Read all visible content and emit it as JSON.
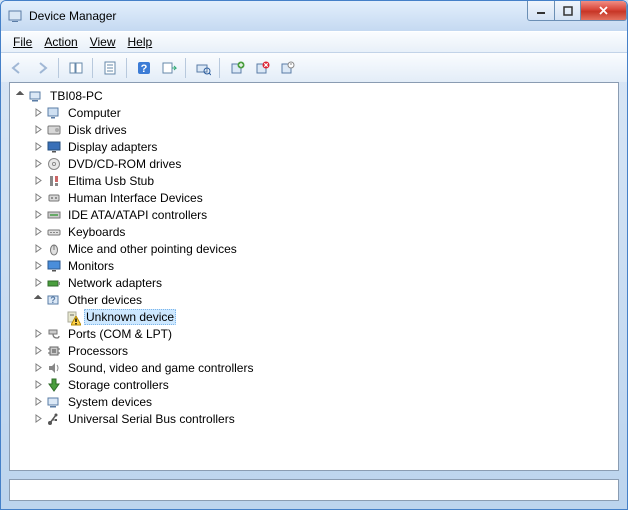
{
  "window": {
    "title": "Device Manager"
  },
  "menu": {
    "file": "File",
    "action": "Action",
    "view": "View",
    "help": "Help"
  },
  "root": {
    "name": "TBI08-PC"
  },
  "categories": [
    {
      "id": "computer",
      "label": "Computer",
      "expanded": false
    },
    {
      "id": "diskdrives",
      "label": "Disk drives",
      "expanded": false
    },
    {
      "id": "display",
      "label": "Display adapters",
      "expanded": false
    },
    {
      "id": "dvd",
      "label": "DVD/CD-ROM drives",
      "expanded": false
    },
    {
      "id": "eltima",
      "label": "Eltima Usb Stub",
      "expanded": false
    },
    {
      "id": "hid",
      "label": "Human Interface Devices",
      "expanded": false
    },
    {
      "id": "ide",
      "label": "IDE ATA/ATAPI controllers",
      "expanded": false
    },
    {
      "id": "keyboards",
      "label": "Keyboards",
      "expanded": false
    },
    {
      "id": "mice",
      "label": "Mice and other pointing devices",
      "expanded": false
    },
    {
      "id": "monitors",
      "label": "Monitors",
      "expanded": false
    },
    {
      "id": "network",
      "label": "Network adapters",
      "expanded": false
    },
    {
      "id": "other",
      "label": "Other devices",
      "expanded": true,
      "children": [
        {
          "id": "unknown",
          "label": "Unknown device",
          "warning": true
        }
      ]
    },
    {
      "id": "ports",
      "label": "Ports (COM & LPT)",
      "expanded": false
    },
    {
      "id": "processors",
      "label": "Processors",
      "expanded": false
    },
    {
      "id": "sound",
      "label": "Sound, video and game controllers",
      "expanded": false
    },
    {
      "id": "storage",
      "label": "Storage controllers",
      "expanded": false
    },
    {
      "id": "system",
      "label": "System devices",
      "expanded": false
    },
    {
      "id": "usb",
      "label": "Universal Serial Bus controllers",
      "expanded": false
    }
  ],
  "selected": "unknown"
}
